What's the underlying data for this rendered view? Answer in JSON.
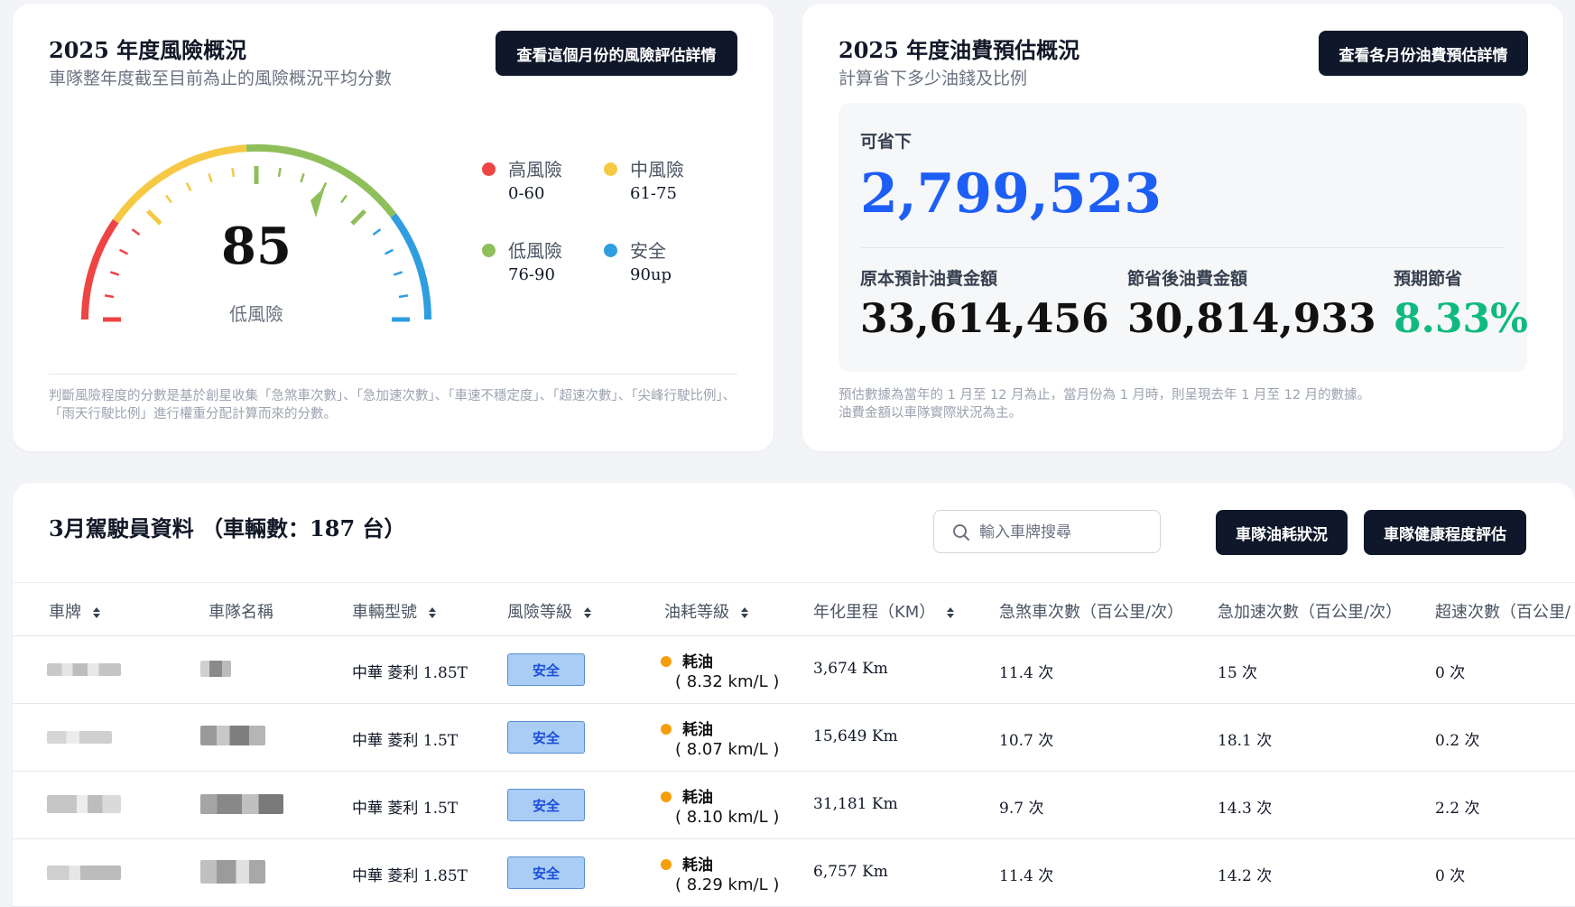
{
  "risk_overview": {
    "title": "2025 年度風險概況",
    "subtitle": "車隊整年度截至目前為止的風險概況平均分數",
    "detail_button": "查看這個月份的風險評估詳情",
    "score": "85",
    "level": "低風險",
    "legend": [
      {
        "label": "高風險",
        "range": "0-60",
        "color": "#ef4444"
      },
      {
        "label": "中風險",
        "range": "61-75",
        "color": "#f6c945"
      },
      {
        "label": "低風險",
        "range": "76-90",
        "color": "#8fbf5a"
      },
      {
        "label": "安全",
        "range": "90up",
        "color": "#2f9de0"
      }
    ],
    "footnote": "判斷風險程度的分數是基於創星收集「急煞車次數」、「急加速次數」、「車速不穩定度」、「超速次數」、「尖峰行駛比例」、「雨天行駛比例」進行權重分配計算而來的分數。"
  },
  "fuel_overview": {
    "title": "2025 年度油費預估概況",
    "subtitle": "計算省下多少油錢及比例",
    "detail_button": "查看各月份油費預估詳情",
    "savable_label": "可省下",
    "savable_value": "2,799,523",
    "original_label": "原本預計油費金額",
    "original_value": "33,614,456",
    "after_label": "節省後油費金額",
    "after_value": "30,814,933",
    "expected_label": "預期節省",
    "expected_value": "8.33%",
    "expected_color": "#10b981",
    "footnote_1": "預估數據為當年的 1 月至 12 月為止，當月份為 1 月時，則呈現去年 1 月至 12 月的數據。",
    "footnote_2": "油費金額以車隊實際狀況為主。"
  },
  "driver_data": {
    "title": "3月駕駛員資料 （車輛數：187 台）",
    "search_placeholder": "輸入車牌搜尋",
    "fuel_status_button": "車隊油耗狀況",
    "health_button": "車隊健康程度評估",
    "columns": [
      "車牌",
      "車隊名稱",
      "車輛型號",
      "風險等級",
      "油耗等級",
      "年化里程（KM）",
      "急煞車次數（百公里/次）",
      "急加速次數（百公里/次）",
      "超速次數（百公里/"
    ],
    "rows": [
      {
        "model": "中華 菱利 1.85T",
        "risk": "安全",
        "fuel_level": "耗油",
        "fuel_rate": "( 8.32 km/L )",
        "mileage": "3,674 Km",
        "brake": "11.4 次",
        "accel": "15 次",
        "speeding": "0 次"
      },
      {
        "model": "中華 菱利 1.5T",
        "risk": "安全",
        "fuel_level": "耗油",
        "fuel_rate": "( 8.07 km/L )",
        "mileage": "15,649 Km",
        "brake": "10.7 次",
        "accel": "18.1 次",
        "speeding": "0.2 次"
      },
      {
        "model": "中華 菱利 1.5T",
        "risk": "安全",
        "fuel_level": "耗油",
        "fuel_rate": "( 8.10 km/L )",
        "mileage": "31,181 Km",
        "brake": "9.7 次",
        "accel": "14.3 次",
        "speeding": "2.2 次"
      },
      {
        "model": "中華 菱利 1.85T",
        "risk": "安全",
        "fuel_level": "耗油",
        "fuel_rate": "( 8.29 km/L )",
        "mileage": "6,757 Km",
        "brake": "11.4 次",
        "accel": "14.2 次",
        "speeding": "0 次"
      }
    ]
  }
}
